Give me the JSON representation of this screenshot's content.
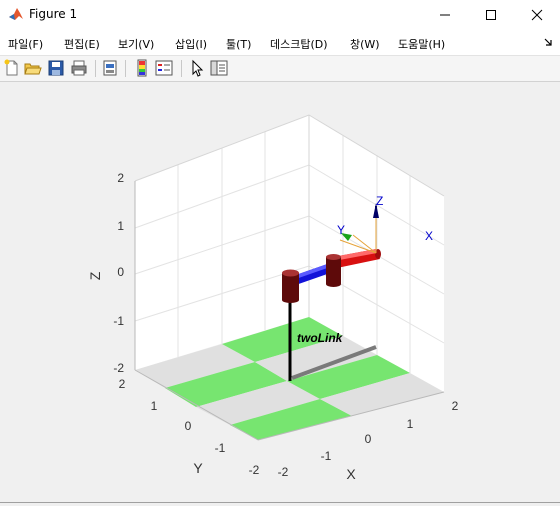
{
  "window": {
    "title": "Figure 1"
  },
  "menu": {
    "file": "파일(F)",
    "edit": "편집(E)",
    "view": "보기(V)",
    "insert": "삽입(I)",
    "tools": "툴(T)",
    "desktop": "데스크탑(D)",
    "window": "창(W)",
    "help": "도움말(H)"
  },
  "toolbar": {
    "icons": [
      "new-figure-icon",
      "open-file-icon",
      "save-icon",
      "print-icon",
      "link-plot-icon",
      "colorbar-icon",
      "legend-icon",
      "pointer-icon",
      "property-inspector-icon"
    ]
  },
  "plot": {
    "z_label": "Z",
    "y_label": "Y",
    "x_label": "X",
    "z_ticks": [
      "2",
      "1",
      "0",
      "-1",
      "-2"
    ],
    "y_ticks": [
      "2",
      "1",
      "0",
      "-1",
      "-2"
    ],
    "x_ticks": [
      "-2",
      "-1",
      "0",
      "1",
      "2"
    ],
    "robot_name": "twoLink",
    "frame_labels": {
      "x": "X",
      "y": "Y",
      "z": "Z"
    },
    "colors": {
      "floor_green": "#77e570",
      "floor_gray": "#e0e0e0",
      "link1": "#1010d8",
      "link2": "#d81010",
      "joint": "#6b0a0a"
    }
  }
}
